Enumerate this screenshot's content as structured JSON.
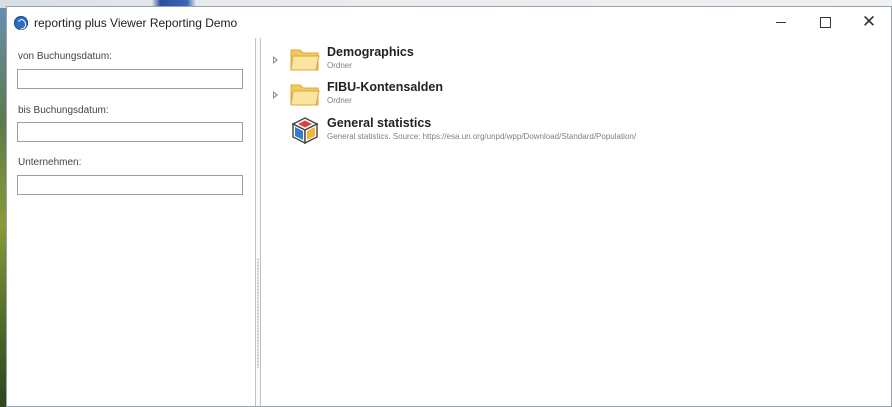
{
  "window": {
    "title": "reporting plus Viewer Reporting Demo",
    "controls": {
      "minimize": "—",
      "maximize": "☐",
      "close": "✕"
    }
  },
  "filters": [
    {
      "label": "von Buchungsdatum:",
      "value": ""
    },
    {
      "label": "bis Buchungsdatum:",
      "value": ""
    },
    {
      "label": "Unternehmen:",
      "value": ""
    }
  ],
  "tree": [
    {
      "name": "Demographics",
      "subtitle": "Ordner",
      "icon": "folder-icon",
      "expandable": true
    },
    {
      "name": "FIBU-Kontensalden",
      "subtitle": "Ordner",
      "icon": "folder-icon",
      "expandable": true
    },
    {
      "name": "General statistics",
      "subtitle": "General statistics. Source: https://esa.un.org/unpd/wpp/Download/Standard/Population/",
      "icon": "cube-icon",
      "expandable": false
    }
  ],
  "colors": {
    "accent": "#2d6cc0",
    "folder": "#f6d27a",
    "label": "#808080"
  }
}
